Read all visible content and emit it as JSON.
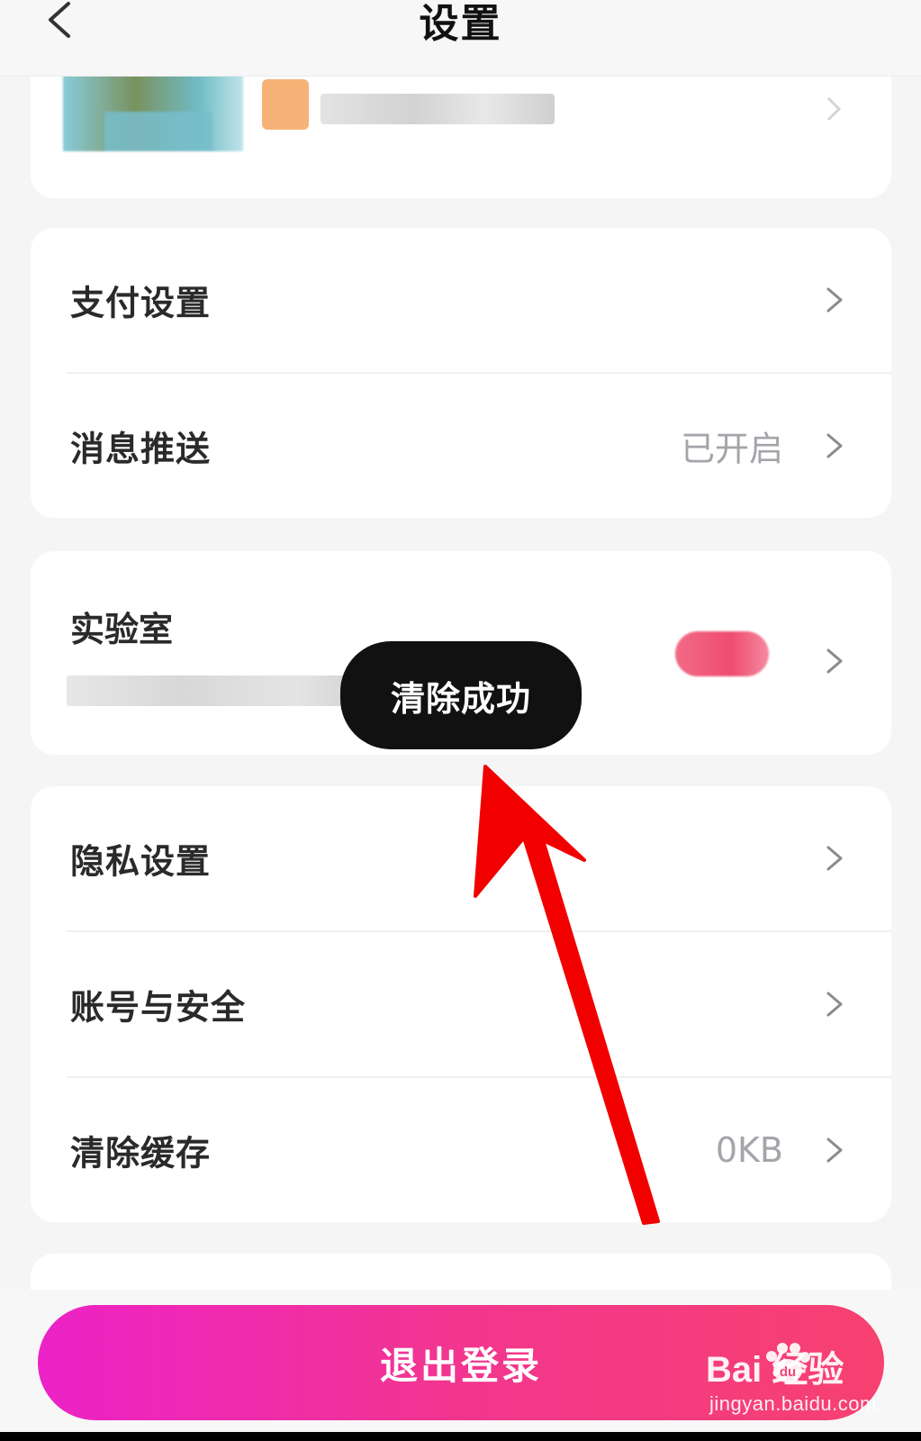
{
  "header": {
    "title": "设置",
    "back_icon": "chevron-left-icon"
  },
  "profile": {
    "avatar": "blurred",
    "id_blurred": true
  },
  "sections": {
    "payment": {
      "label": "支付设置"
    },
    "push": {
      "label": "消息推送",
      "value": "已开启"
    },
    "lab": {
      "label": "实验室"
    },
    "privacy": {
      "label": "隐私设置"
    },
    "account": {
      "label": "账号与安全"
    },
    "cache": {
      "label": "清除缓存",
      "value": "0KB"
    }
  },
  "toast": {
    "text": "清除成功"
  },
  "logout": {
    "label": "退出登录"
  },
  "watermark": {
    "brand": "Bai  经验",
    "url": "jingyan.baidu.com"
  },
  "colors": {
    "accent_start": "#ec22c7",
    "accent_end": "#f7416f",
    "arrow": "#f20000",
    "toast_bg": "#111111"
  }
}
